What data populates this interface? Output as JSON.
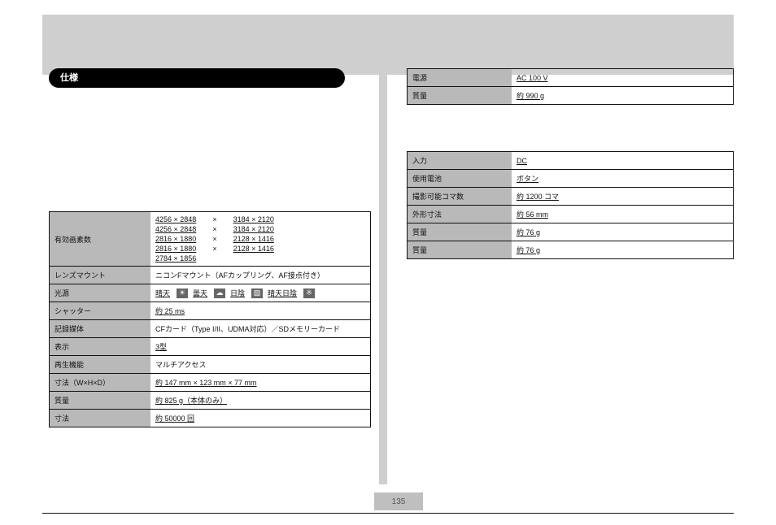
{
  "pill_title": "仕様",
  "page_number": "135",
  "left_table": {
    "rows": [
      {
        "label": "有効画素数",
        "pixels": [
          [
            "4256 × 2848",
            "3184 × 2120"
          ],
          [
            "4256 × 2848",
            "3184 × 2120"
          ],
          [
            "2816 × 1880",
            "2128 × 1416"
          ],
          [
            "2816 × 1880",
            "2128 × 1416"
          ],
          [
            "2784 × 1856",
            ""
          ]
        ]
      },
      {
        "label": "レンズマウント",
        "value": "ニコンFマウント（AFカップリング、AF接点付き）"
      },
      {
        "label": "光源",
        "light": [
          {
            "text": "晴天",
            "icon": "sun-icon",
            "glyph": "☀"
          },
          {
            "text": "曇天",
            "icon": "cloud-icon",
            "glyph": "☁"
          },
          {
            "text": "日陰",
            "icon": "shade-icon",
            "glyph": "▧"
          },
          {
            "text": "晴天日陰",
            "icon": "shade-sun-icon",
            "glyph": "※"
          }
        ]
      },
      {
        "label": "シャッター",
        "value": "約 25 ms"
      },
      {
        "label": "記録媒体",
        "value": "CFカード（Type I/II、UDMA対応）／SDメモリーカード"
      },
      {
        "label": "表示",
        "value": "3型"
      },
      {
        "label": "再生機能",
        "value": "マルチアクセス"
      },
      {
        "label": "寸法（W×H×D）",
        "value": "約 147 mm × 123 mm × 77 mm"
      },
      {
        "label": "質量",
        "value": "約 825 g（本体のみ）"
      },
      {
        "label": "寸法",
        "value": "約 50000 回"
      }
    ]
  },
  "right_table_1": {
    "rows": [
      {
        "label": "電源",
        "value": "AC 100 V"
      },
      {
        "label": "質量",
        "value": "約 990 g"
      }
    ]
  },
  "right_table_2": {
    "rows": [
      {
        "label": "入力",
        "value": "DC"
      },
      {
        "label": "使用電池",
        "value": "ボタン"
      },
      {
        "label": "撮影可能コマ数",
        "value": "約 1200 コマ"
      },
      {
        "label": "外形寸法",
        "value": "約 56 mm"
      },
      {
        "label": "質量",
        "value": "約 76 g"
      },
      {
        "label": "質量",
        "value": "約 76 g"
      }
    ]
  }
}
